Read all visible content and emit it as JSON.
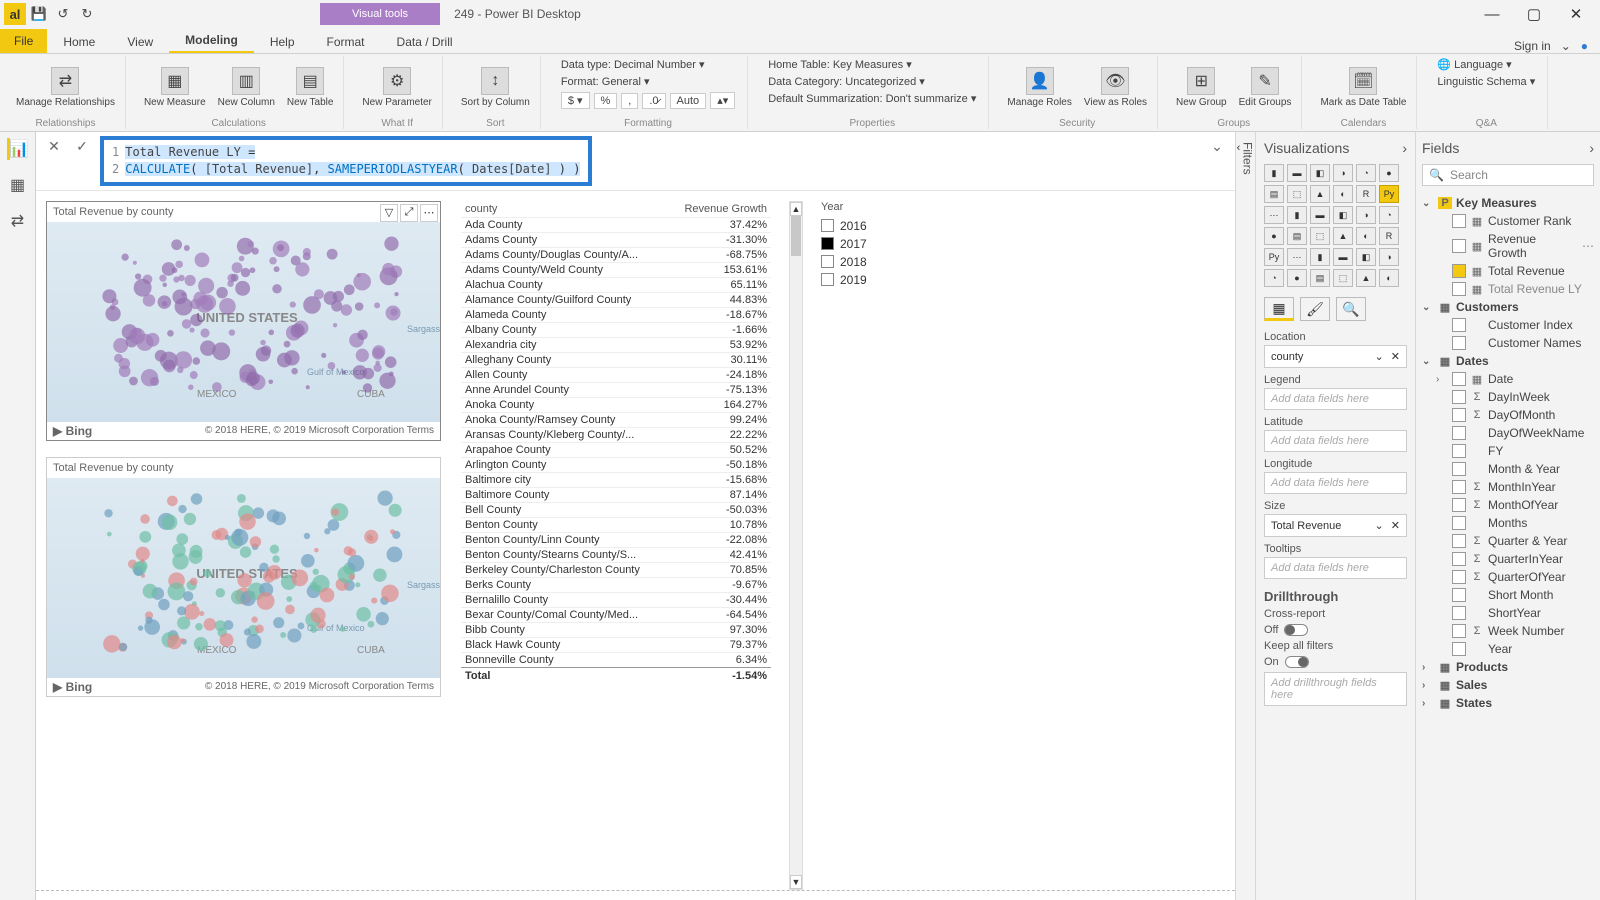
{
  "window": {
    "visual_tools": "Visual tools",
    "title": "249 - Power BI Desktop",
    "signin": "Sign in"
  },
  "tabs": [
    "Home",
    "View",
    "Modeling",
    "Help",
    "Format",
    "Data / Drill"
  ],
  "active_tab": "Modeling",
  "file_tab": "File",
  "ribbon": {
    "manage_rel": "Manage\nRelationships",
    "new_measure": "New\nMeasure",
    "new_column": "New\nColumn",
    "new_table": "New\nTable",
    "new_parameter": "New\nParameter",
    "sort_by": "Sort by\nColumn",
    "data_type": "Data type: Decimal Number ▾",
    "format": "Format: General ▾",
    "auto": "Auto",
    "home_table": "Home Table: Key Measures ▾",
    "data_category": "Data Category: Uncategorized ▾",
    "default_sum": "Default Summarization: Don't summarize ▾",
    "manage_roles": "Manage\nRoles",
    "view_as": "View as\nRoles",
    "new_group": "New\nGroup",
    "edit_groups": "Edit\nGroups",
    "mark_date": "Mark as\nDate Table",
    "language": "Language ▾",
    "ling": "Linguistic Schema ▾",
    "g_rel": "Relationships",
    "g_calc": "Calculations",
    "g_whatif": "What If",
    "g_sort": "Sort",
    "g_fmt": "Formatting",
    "g_props": "Properties",
    "g_sec": "Security",
    "g_groups": "Groups",
    "g_cal": "Calendars",
    "g_qa": "Q&A"
  },
  "formula": {
    "line1_name": "Total Revenue LY",
    "line1_eq": "=",
    "line2_fn1": "CALCULATE",
    "line2_arg1": "[Total Revenue]",
    "line2_fn2": "SAMEPERIODLASTYEAR",
    "line2_arg2": "Dates[Date]"
  },
  "maps": {
    "title1": "Total Revenue by county",
    "title2": "Total Revenue by county",
    "bing": "▶ Bing",
    "copyright": "© 2018 HERE, © 2019 Microsoft Corporation Terms",
    "label_us": "UNITED STATES",
    "label_mx": "MEXICO",
    "label_cu": "CUBA",
    "label_gulf": "Gulf of\nMexico",
    "label_sarg": "Sargasso Sea"
  },
  "table": {
    "col1": "county",
    "col2": "Revenue Growth",
    "total_label": "Total",
    "total_value": "-1.54%",
    "rows": [
      {
        "c": "Ada County",
        "v": "37.42%"
      },
      {
        "c": "Adams County",
        "v": "-31.30%"
      },
      {
        "c": "Adams County/Douglas County/A...",
        "v": "-68.75%"
      },
      {
        "c": "Adams County/Weld County",
        "v": "153.61%"
      },
      {
        "c": "Alachua County",
        "v": "65.11%"
      },
      {
        "c": "Alamance County/Guilford County",
        "v": "44.83%"
      },
      {
        "c": "Alameda County",
        "v": "-18.67%"
      },
      {
        "c": "Albany County",
        "v": "-1.66%"
      },
      {
        "c": "Alexandria city",
        "v": "53.92%"
      },
      {
        "c": "Alleghany County",
        "v": "30.11%"
      },
      {
        "c": "Allen County",
        "v": "-24.18%"
      },
      {
        "c": "Anne Arundel County",
        "v": "-75.13%"
      },
      {
        "c": "Anoka County",
        "v": "164.27%"
      },
      {
        "c": "Anoka County/Ramsey County",
        "v": "99.24%"
      },
      {
        "c": "Aransas County/Kleberg County/...",
        "v": "22.22%"
      },
      {
        "c": "Arapahoe County",
        "v": "50.52%"
      },
      {
        "c": "Arlington County",
        "v": "-50.18%"
      },
      {
        "c": "Baltimore city",
        "v": "-15.68%"
      },
      {
        "c": "Baltimore County",
        "v": "87.14%"
      },
      {
        "c": "Bell County",
        "v": "-50.03%"
      },
      {
        "c": "Benton County",
        "v": "10.78%"
      },
      {
        "c": "Benton County/Linn County",
        "v": "-22.08%"
      },
      {
        "c": "Benton County/Stearns County/S...",
        "v": "42.41%"
      },
      {
        "c": "Berkeley County/Charleston County",
        "v": "70.85%"
      },
      {
        "c": "Berks County",
        "v": "-9.67%"
      },
      {
        "c": "Bernalillo County",
        "v": "-30.44%"
      },
      {
        "c": "Bexar County/Comal County/Med...",
        "v": "-64.54%"
      },
      {
        "c": "Bibb County",
        "v": "97.30%"
      },
      {
        "c": "Black Hawk County",
        "v": "79.37%"
      },
      {
        "c": "Bonneville County",
        "v": "6.34%"
      }
    ]
  },
  "slicer": {
    "header": "Year",
    "options": [
      {
        "label": "2016",
        "checked": false
      },
      {
        "label": "2017",
        "checked": true
      },
      {
        "label": "2018",
        "checked": false
      },
      {
        "label": "2019",
        "checked": false
      }
    ]
  },
  "filters_label": "Filters",
  "viz": {
    "header": "Visualizations",
    "well_location": "Location",
    "well_legend": "Legend",
    "well_latitude": "Latitude",
    "well_longitude": "Longitude",
    "well_size": "Size",
    "well_tooltips": "Tooltips",
    "location_field": "county",
    "size_field": "Total Revenue",
    "placeholder": "Add data fields here",
    "drill_header": "Drillthrough",
    "cross": "Cross-report",
    "off": "Off",
    "keep": "Keep all filters",
    "on": "On",
    "drill_ph": "Add drillthrough fields here"
  },
  "fields": {
    "header": "Fields",
    "search": "Search",
    "tables": {
      "key_measures": "Key Measures",
      "customers": "Customers",
      "dates": "Dates",
      "products": "Products",
      "sales": "Sales",
      "states": "States"
    },
    "key_measures_items": [
      {
        "n": "Customer Rank",
        "check": false,
        "icon": "▦"
      },
      {
        "n": "Revenue Growth",
        "check": false,
        "icon": "▦",
        "hover": true
      },
      {
        "n": "Total Revenue",
        "check": true,
        "icon": "▦"
      },
      {
        "n": "Total Revenue LY",
        "check": false,
        "icon": "▦",
        "dim": true
      }
    ],
    "customers_items": [
      {
        "n": "Customer Index"
      },
      {
        "n": "Customer Names"
      }
    ],
    "dates_items": [
      {
        "n": "Date",
        "icon": "▦",
        "expand": true
      },
      {
        "n": "DayInWeek",
        "icon": "Σ"
      },
      {
        "n": "DayOfMonth",
        "icon": "Σ"
      },
      {
        "n": "DayOfWeekName"
      },
      {
        "n": "FY"
      },
      {
        "n": "Month & Year"
      },
      {
        "n": "MonthInYear",
        "icon": "Σ"
      },
      {
        "n": "MonthOfYear",
        "icon": "Σ"
      },
      {
        "n": "Months"
      },
      {
        "n": "Quarter & Year",
        "icon": "Σ"
      },
      {
        "n": "QuarterInYear",
        "icon": "Σ"
      },
      {
        "n": "QuarterOfYear",
        "icon": "Σ"
      },
      {
        "n": "Short Month"
      },
      {
        "n": "ShortYear"
      },
      {
        "n": "Week Number",
        "icon": "Σ"
      },
      {
        "n": "Year"
      }
    ]
  }
}
